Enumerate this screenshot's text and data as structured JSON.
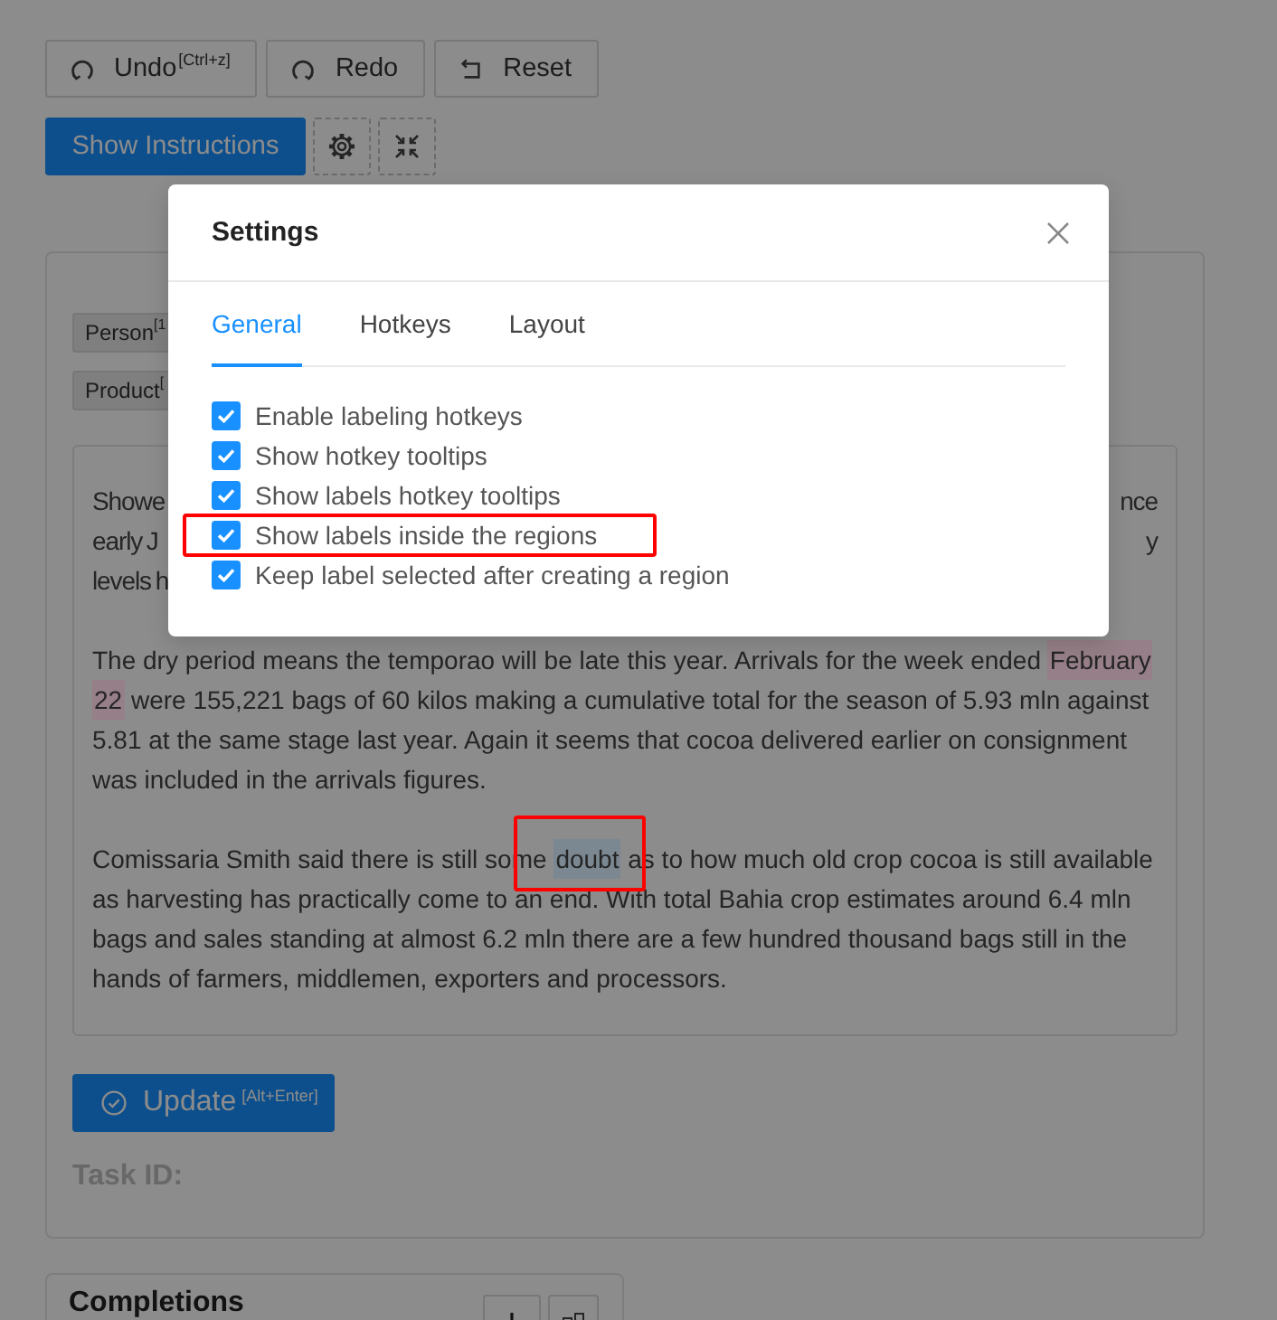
{
  "toolbar": {
    "buttons": [
      {
        "kind": "undo",
        "label": "Undo",
        "hotkey": "[Ctrl+z]"
      },
      {
        "kind": "redo",
        "label": "Redo"
      },
      {
        "kind": "reset",
        "label": "Reset"
      }
    ]
  },
  "controls": {
    "instructions_button": "Show Instructions",
    "icon_buttons": [
      {
        "kind": "settings"
      },
      {
        "kind": "collapse"
      }
    ]
  },
  "labels": [
    {
      "text": "Person",
      "hotkey": "[1"
    },
    {
      "text": "Product",
      "hotkey": "["
    }
  ],
  "document": {
    "paragraphs": [
      {
        "kind": "covered",
        "lines": [
          {
            "left": "Showe",
            "right": "nce"
          },
          {
            "left": "early J",
            "right": "y"
          },
          {
            "left": "levels h"
          }
        ]
      },
      {
        "kind": "text",
        "lines": [
          {
            "segments": [
              {
                "kind": "plain",
                "text": "The dry period means the temporao will be late this year. Arrivals for the week ended "
              },
              {
                "kind": "entity",
                "text": "February",
                "color": "#967f88",
                "annotated": false
              }
            ]
          },
          {
            "segments": [
              {
                "kind": "entity",
                "text": "22",
                "color": "#967f88",
                "annotated": false
              },
              {
                "kind": "plain",
                "text": " were 155,221 bags of 60 kilos making a cumulative total for the season of 5.93 mln against"
              }
            ]
          },
          {
            "segments": [
              {
                "kind": "plain",
                "text": "5.81 at the same stage last year. Again it seems that cocoa delivered earlier on consignment"
              }
            ]
          },
          {
            "segments": [
              {
                "kind": "plain",
                "text": "was included in the arrivals figures."
              }
            ]
          }
        ]
      },
      {
        "kind": "text",
        "lines": [
          {
            "segments": [
              {
                "kind": "plain",
                "text": "Comissaria Smith said there is still some "
              },
              {
                "kind": "entity",
                "text": "doubt",
                "color": "#7c8891",
                "annotated": true
              },
              {
                "kind": "plain",
                "text": " as to how much old crop cocoa is still available"
              }
            ]
          },
          {
            "segments": [
              {
                "kind": "plain",
                "text": "as harvesting has practically come to an end. With total Bahia crop estimates around 6.4 mln"
              }
            ]
          },
          {
            "segments": [
              {
                "kind": "plain",
                "text": "bags and sales standing at almost 6.2 mln there are a few hundred thousand bags still in the"
              }
            ]
          },
          {
            "segments": [
              {
                "kind": "plain",
                "text": "hands of farmers, middlemen, exporters and processors."
              }
            ]
          }
        ]
      }
    ]
  },
  "update_button": {
    "label": "Update",
    "hotkey": "[Alt+Enter]"
  },
  "task_id": {
    "label": "Task ID:"
  },
  "completions": {
    "title": "Completions",
    "buttons": [
      {
        "kind": "add"
      },
      {
        "kind": "grid"
      }
    ]
  },
  "settings": {
    "title": "Settings",
    "tabs": [
      {
        "label": "General",
        "selected": true
      },
      {
        "label": "Hotkeys",
        "selected": false
      },
      {
        "label": "Layout",
        "selected": false
      }
    ],
    "options": [
      {
        "label": "Enable labeling hotkeys",
        "checked": true,
        "annotated": false
      },
      {
        "label": "Show hotkey tooltips",
        "checked": true,
        "annotated": false
      },
      {
        "label": "Show labels hotkey tooltips",
        "checked": true,
        "annotated": false
      },
      {
        "label": "Show labels inside the regions",
        "checked": true,
        "annotated": true
      },
      {
        "label": "Keep label selected after creating a region",
        "checked": true,
        "annotated": false
      }
    ]
  }
}
